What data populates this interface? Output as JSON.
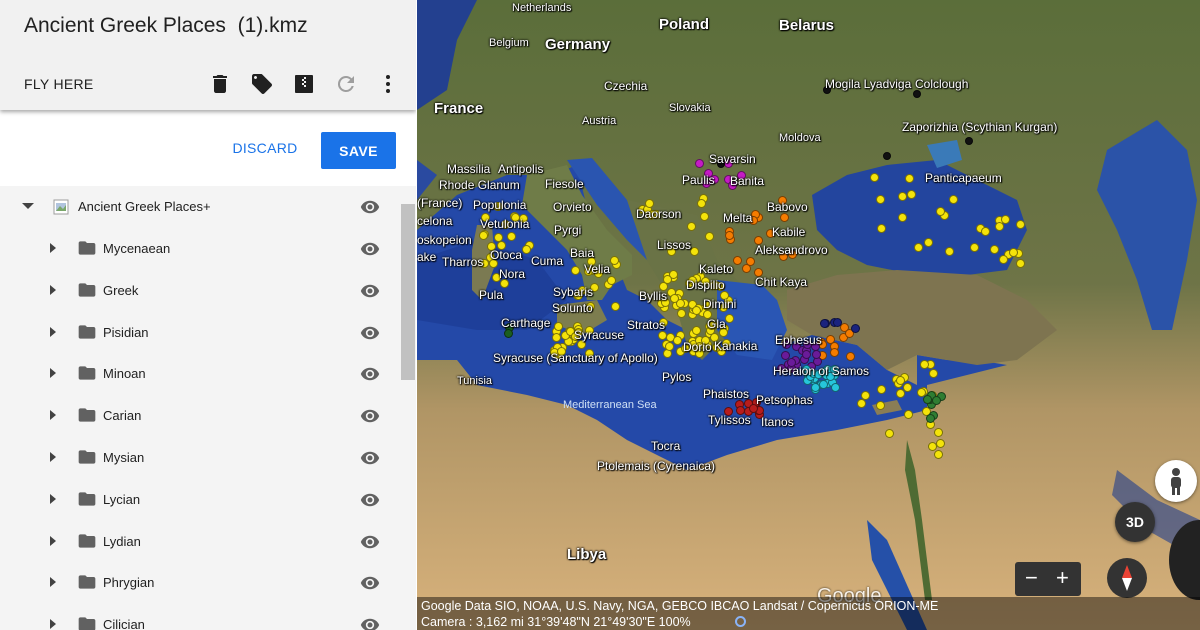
{
  "panel": {
    "title": "Ancient Greek Places  (1).kmz",
    "fly_here": "FLY HERE",
    "toolbar_icons": [
      "delete-icon",
      "label-icon",
      "zip-icon",
      "refresh-icon",
      "more-vert-icon"
    ],
    "discard": "DISCARD",
    "save": "SAVE",
    "root": {
      "label": "Ancient Greek Places+",
      "expanded": true
    },
    "folders": [
      "Mycenaean",
      "Greek",
      "Pisidian",
      "Minoan",
      "Carian",
      "Mysian",
      "Lycian",
      "Lydian",
      "Phrygian",
      "Cilician"
    ]
  },
  "map": {
    "countries": [
      "Netherlands",
      "Poland",
      "Belarus",
      "Belgium",
      "Germany",
      "Czechia",
      "Slovakia",
      "Austria",
      "France",
      "Moldova",
      "Tunisia",
      "Libya"
    ],
    "places": [
      "Mogila Lyadviga",
      "Colclough",
      "Zaporizhia (Scythian Kurgan)",
      "Savarsin",
      "Paulis",
      "Banita",
      "Panticapaeum",
      "Massilia",
      "Antipolis",
      "Rhode Glanum",
      "(France)",
      "Populonia",
      "Fiesole",
      "Orvieto",
      "Daorson",
      "Melta",
      "Babovo",
      "Kabile",
      "Aleksandrovo",
      "Vetulonia",
      "celona",
      "Pyrgi",
      "Lissos",
      "oskopeion",
      "Baia",
      "Kaleto",
      "Chit Kaya",
      "Tharros",
      "Otoca",
      "Cuma",
      "Velia",
      "Nora",
      "Dispilio",
      "Pula",
      "Sybaris",
      "Byllis",
      "Dimini",
      "Solunto",
      "Carthage",
      "Stratos",
      "Gla",
      "Syracuse",
      "Dorio",
      "Kanakia",
      "Ephesus",
      "Syracuse (Sanctuary of Apollo)",
      "Pylos",
      "Heraion of Samos",
      "Phaistos",
      "Petsophas",
      "Tylissos",
      "Itanos",
      "Tocra",
      "Ptolemais (Cyrenaica)",
      "ake"
    ],
    "sea_label": "Mediterranean Sea",
    "btn_3d": "3D",
    "zoom_out": "−",
    "zoom_in": "+",
    "watermark": "Google",
    "attribution": "Google   Data SIO, NOAA, U.S. Navy, NGA, GEBCO  IBCAO   Landsat / Copernicus   ORION-ME",
    "camera": "Camera :   3,162 mi    31°39'48\"N 21°49'30\"E    100%"
  }
}
